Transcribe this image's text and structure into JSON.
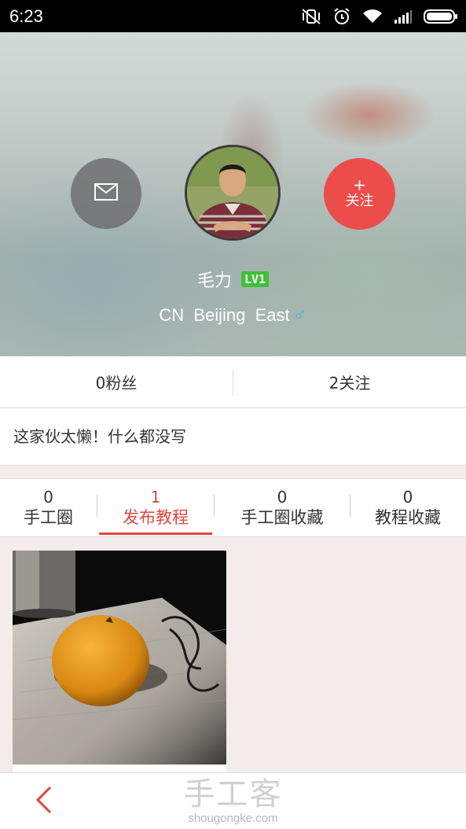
{
  "status_bar": {
    "time": "6:23",
    "icons": [
      "vibrate-off-icon",
      "alarm-icon",
      "wifi-icon",
      "signal-icon",
      "battery-icon"
    ]
  },
  "profile": {
    "name": "毛力",
    "level_badge": "LV1",
    "location": "CN  Beijing  East",
    "gender_icon": "male-icon",
    "message_icon": "envelope-icon",
    "follow_plus": "+",
    "follow_label": "关注"
  },
  "counts": {
    "fans": "0粉丝",
    "following": "2关注"
  },
  "bio": "这家伙太懒！什么都没写",
  "tabs": [
    {
      "count": "0",
      "label": "手工圈",
      "active": false
    },
    {
      "count": "1",
      "label": "发布教程",
      "active": true
    },
    {
      "count": "0",
      "label": "手工圈收藏",
      "active": false
    },
    {
      "count": "0",
      "label": "教程收藏",
      "active": false
    }
  ],
  "colors": {
    "accent": "#e0473f",
    "follow_button": "#ec4d4a",
    "level_badge": "#3fbf3a",
    "gender": "#32c4d8"
  },
  "bottom_bar": {
    "back_icon": "chevron-left-icon",
    "watermark_logo": "手工客",
    "watermark_url": "shougongke.com"
  }
}
